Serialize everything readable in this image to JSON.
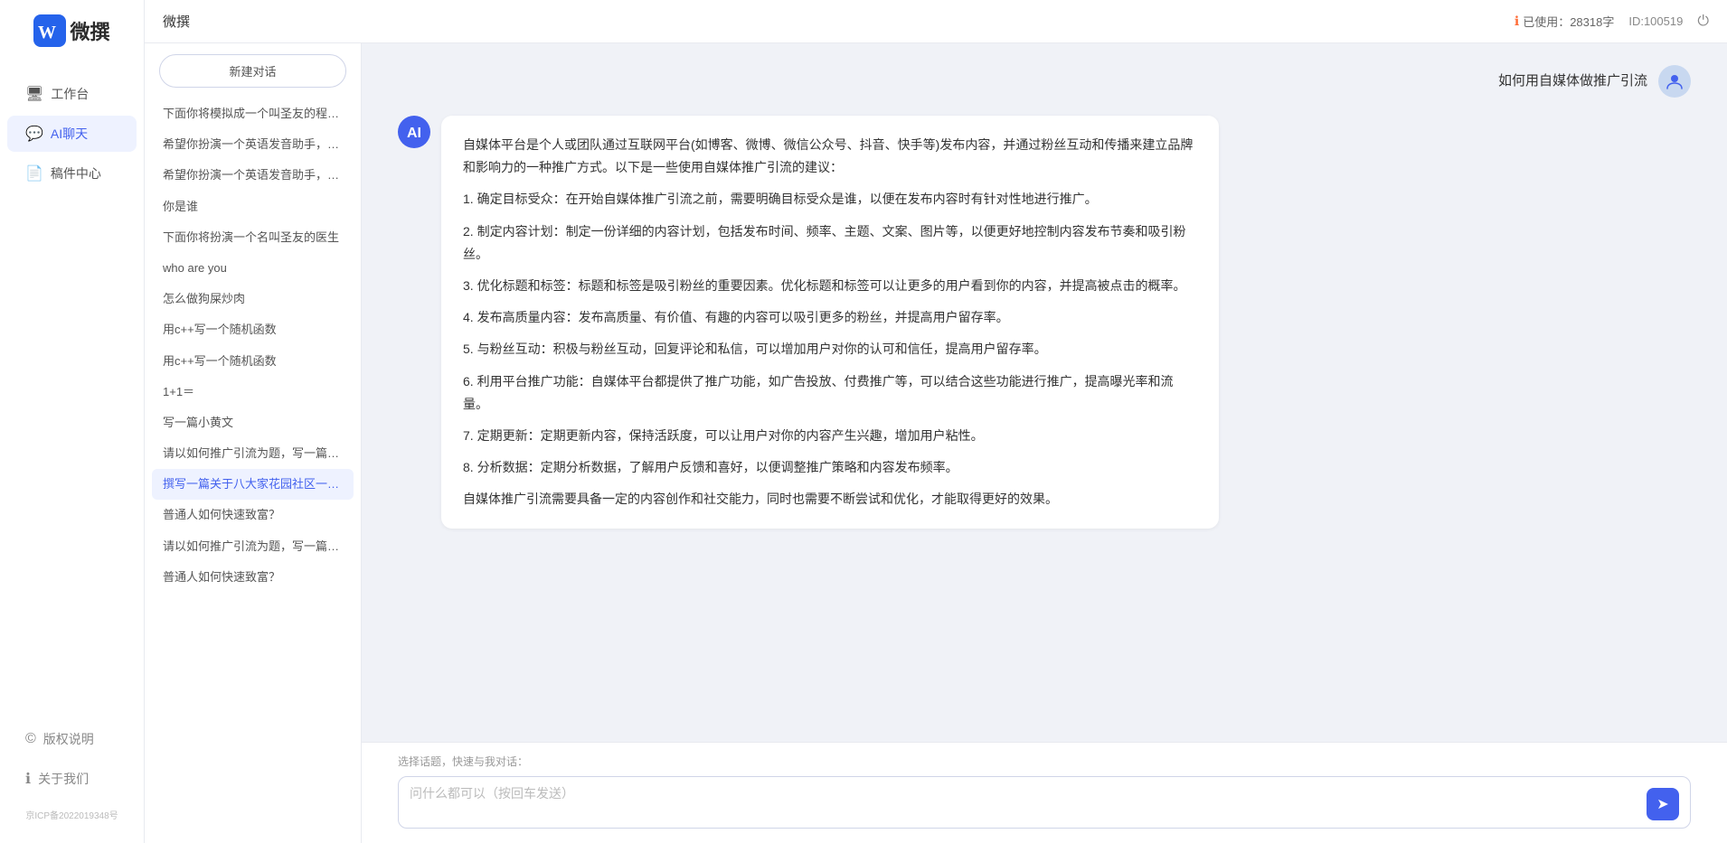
{
  "app": {
    "name": "微撰",
    "page_title": "微撰"
  },
  "header": {
    "title": "微撰",
    "usage_label": "已使用：28318字",
    "usage_icon": "ℹ",
    "id_label": "ID:100519",
    "power_icon": "⏻"
  },
  "sidebar": {
    "nav_items": [
      {
        "id": "workbench",
        "label": "工作台",
        "icon": "🖥"
      },
      {
        "id": "ai-chat",
        "label": "AI聊天",
        "icon": "💬",
        "active": true
      },
      {
        "id": "drafts",
        "label": "稿件中心",
        "icon": "📄"
      }
    ],
    "bottom_items": [
      {
        "id": "copyright",
        "label": "版权说明",
        "icon": "©"
      },
      {
        "id": "about",
        "label": "关于我们",
        "icon": "ℹ"
      }
    ],
    "icp": "京ICP备2022019348号"
  },
  "history": {
    "new_chat_label": "新建对话",
    "items": [
      {
        "id": "h1",
        "text": "下面你将模拟成一个叫圣友的程序员，我说...",
        "active": false
      },
      {
        "id": "h2",
        "text": "希望你扮演一个英语发音助手，我提供给你...",
        "active": false
      },
      {
        "id": "h3",
        "text": "希望你扮演一个英语发音助手，我提供给你...",
        "active": false
      },
      {
        "id": "h4",
        "text": "你是谁",
        "active": false
      },
      {
        "id": "h5",
        "text": "下面你将扮演一个名叫圣友的医生",
        "active": false
      },
      {
        "id": "h6",
        "text": "who are you",
        "active": false
      },
      {
        "id": "h7",
        "text": "怎么做狗屎炒肉",
        "active": false
      },
      {
        "id": "h8",
        "text": "用c++写一个随机函数",
        "active": false
      },
      {
        "id": "h9",
        "text": "用c++写一个随机函数",
        "active": false
      },
      {
        "id": "h10",
        "text": "1+1＝",
        "active": false
      },
      {
        "id": "h11",
        "text": "写一篇小黄文",
        "active": false
      },
      {
        "id": "h12",
        "text": "请以如何推广引流为题，写一篇大纲",
        "active": false
      },
      {
        "id": "h13",
        "text": "撰写一篇关于八大家花园社区一刻钟便民生...",
        "active": true
      },
      {
        "id": "h14",
        "text": "普通人如何快速致富？",
        "active": false
      },
      {
        "id": "h15",
        "text": "请以如何推广引流为题，写一篇大纲",
        "active": false
      },
      {
        "id": "h16",
        "text": "普通人如何快速致富？",
        "active": false
      }
    ]
  },
  "chat": {
    "messages": [
      {
        "type": "user",
        "text": "如何用自媒体做推广引流",
        "avatar_type": "user"
      },
      {
        "type": "ai",
        "paragraphs": [
          "自媒体平台是个人或团队通过互联网平台(如博客、微博、微信公众号、抖音、快手等)发布内容，并通过粉丝互动和传播来建立品牌和影响力的一种推广方式。以下是一些使用自媒体推广引流的建议：",
          "1. 确定目标受众：在开始自媒体推广引流之前，需要明确目标受众是谁，以便在发布内容时有针对性地进行推广。",
          "2. 制定内容计划：制定一份详细的内容计划，包括发布时间、频率、主题、文案、图片等，以便更好地控制内容发布节奏和吸引粉丝。",
          "3. 优化标题和标签：标题和标签是吸引粉丝的重要因素。优化标题和标签可以让更多的用户看到你的内容，并提高被点击的概率。",
          "4. 发布高质量内容：发布高质量、有价值、有趣的内容可以吸引更多的粉丝，并提高用户留存率。",
          "5. 与粉丝互动：积极与粉丝互动，回复评论和私信，可以增加用户对你的认可和信任，提高用户留存率。",
          "6. 利用平台推广功能：自媒体平台都提供了推广功能，如广告投放、付费推广等，可以结合这些功能进行推广，提高曝光率和流量。",
          "7. 定期更新：定期更新内容，保持活跃度，可以让用户对你的内容产生兴趣，增加用户粘性。",
          "8. 分析数据：定期分析数据，了解用户反馈和喜好，以便调整推广策略和内容发布频率。",
          "自媒体推广引流需要具备一定的内容创作和社交能力，同时也需要不断尝试和优化，才能取得更好的效果。"
        ]
      }
    ],
    "quick_topics_label": "选择话题，快速与我对话：",
    "input_placeholder": "问什么都可以（按回车发送）",
    "send_icon": "➤"
  }
}
